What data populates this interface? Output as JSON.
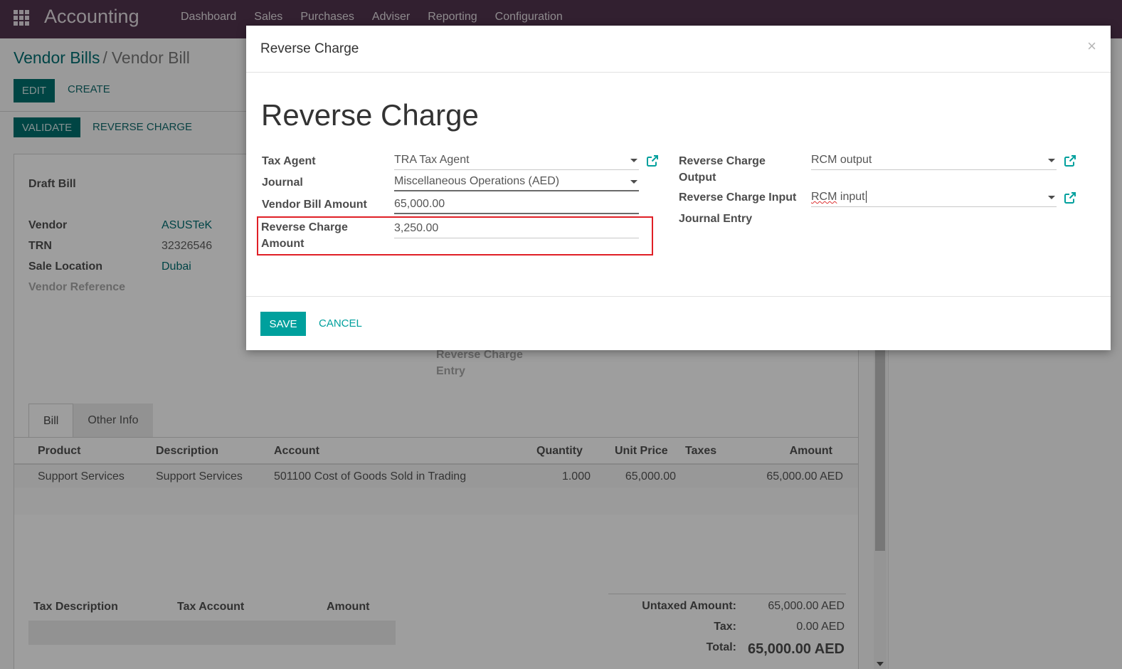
{
  "navbar": {
    "brand": "Accounting",
    "menu": [
      "Dashboard",
      "Sales",
      "Purchases",
      "Adviser",
      "Reporting",
      "Configuration"
    ]
  },
  "background": {
    "breadcrumb": {
      "parent": "Vendor Bills",
      "separator": "/",
      "current": "Vendor Bill"
    },
    "buttons": {
      "edit": "EDIT",
      "create": "CREATE",
      "validate": "VALIDATE",
      "reverse_charge": "REVERSE CHARGE"
    },
    "sheet": {
      "status_title": "Draft Bill",
      "fields": [
        {
          "label": "Vendor",
          "value": "ASUSTeK"
        },
        {
          "label": "TRN",
          "value": "32326546"
        },
        {
          "label": "Sale Location",
          "value": "Dubai"
        },
        {
          "label": "Vendor Reference",
          "value": ""
        }
      ],
      "reverse_charge_entry_label": "Reverse Charge Entry",
      "tabs": [
        "Bill",
        "Other Info"
      ],
      "lines_columns": [
        "Product",
        "Description",
        "Account",
        "Quantity",
        "Unit Price",
        "Taxes",
        "Amount"
      ],
      "lines": [
        {
          "product": "Support Services",
          "description": "Support Services",
          "account": "501100 Cost of Goods Sold in Trading",
          "quantity": "1.000",
          "unit_price": "65,000.00",
          "taxes": "",
          "amount": "65,000.00 AED"
        }
      ],
      "tax_columns": [
        "Tax Description",
        "Tax Account",
        "Amount"
      ],
      "totals": [
        {
          "label": "Untaxed Amount:",
          "value": "65,000.00 AED"
        },
        {
          "label": "Tax:",
          "value": "0.00 AED"
        },
        {
          "label": "Total:",
          "value": "65,000.00 AED"
        }
      ]
    }
  },
  "modal": {
    "header_title": "Reverse Charge",
    "close_glyph": "×",
    "form_title": "Reverse Charge",
    "left_fields": {
      "tax_agent": {
        "label": "Tax Agent",
        "value": "TRA Tax Agent"
      },
      "journal": {
        "label": "Journal",
        "value": "Miscellaneous Operations (AED)"
      },
      "vendor_bill_amount": {
        "label": "Vendor Bill Amount",
        "value": "65,000.00"
      },
      "reverse_charge_amount": {
        "label_line1": "Reverse Charge",
        "label_line2": "Amount",
        "value": "3,250.00"
      }
    },
    "right_fields": {
      "rc_output": {
        "label_line1": "Reverse Charge",
        "label_line2": "Output",
        "value": "RCM output"
      },
      "rc_input": {
        "label": "Reverse Charge Input",
        "value_misspelled": "RCM",
        "value_rest": " input"
      },
      "journal_entry": {
        "label": "Journal Entry",
        "value": ""
      }
    },
    "footer": {
      "save": "SAVE",
      "cancel": "CANCEL"
    },
    "highlight_color": "#e01f26",
    "accent_color": "#00a09d"
  }
}
